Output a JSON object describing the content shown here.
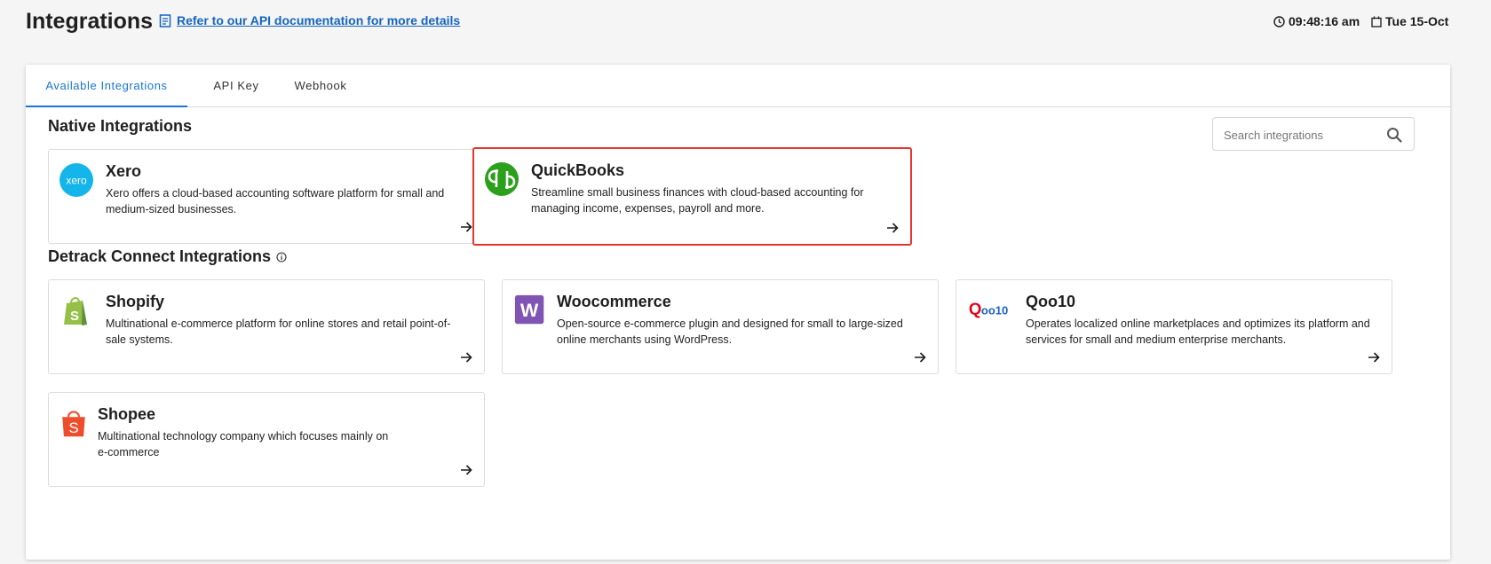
{
  "header": {
    "title": "Integrations",
    "doc_link": "Refer to our API documentation for more details",
    "time": "09:48:16 am",
    "date": "Tue 15-Oct"
  },
  "tabs": [
    {
      "label": "Available Integrations",
      "active": true
    },
    {
      "label": "API Key",
      "active": false
    },
    {
      "label": "Webhook",
      "active": false
    }
  ],
  "search": {
    "placeholder": "Search integrations"
  },
  "native": {
    "title": "Native Integrations",
    "cards": [
      {
        "name": "Xero",
        "description": "Xero offers a cloud-based accounting software platform for small and medium-sized businesses.",
        "logo_text": "xero",
        "logo_color": "#13b5ea"
      },
      {
        "name": "QuickBooks",
        "description": "Streamline small business finances with cloud-based accounting for managing income, expenses, payroll and more.",
        "logo_text": "qb",
        "logo_color": "#2ca01c",
        "highlighted": true
      }
    ]
  },
  "detrack": {
    "title": "Detrack Connect Integrations",
    "cards": [
      {
        "name": "Shopify",
        "description": "Multinational e-commerce platform for online stores and retail point-of-sale systems.",
        "logo_color": "#95bf47"
      },
      {
        "name": "Woocommerce",
        "description": "Open-source e-commerce plugin and designed for small to large-sized online merchants using WordPress.",
        "logo_text": "W",
        "logo_color": "#7f54b3"
      },
      {
        "name": "Qoo10",
        "description": "Operates localized online marketplaces and optimizes its platform and services for small and medium enterprise merchants.",
        "logo_text": "Qoo10",
        "logo_color": "#e3001b"
      },
      {
        "name": "Shopee",
        "description": "Multinational technology company which focuses mainly on e-commerce",
        "logo_text": "S",
        "logo_color": "#ee4d2d"
      }
    ]
  }
}
